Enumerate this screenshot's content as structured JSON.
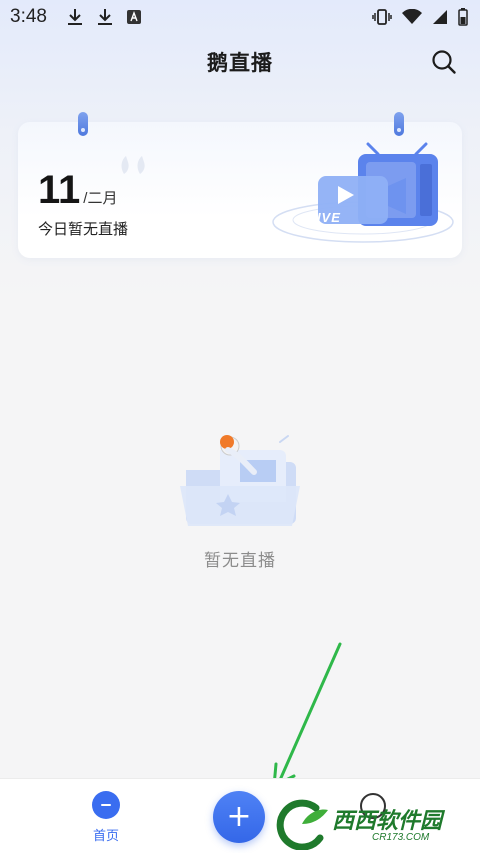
{
  "status_bar": {
    "time": "3:48",
    "left_icons": [
      "download-icon",
      "download-icon",
      "keyboard-a-icon"
    ],
    "right_icons": [
      "vibrate-icon",
      "wifi-icon",
      "signal-icon",
      "battery-icon"
    ]
  },
  "header": {
    "title": "鹅直播",
    "search_icon": "search-icon"
  },
  "calendar_card": {
    "day": "11",
    "slash": "/",
    "month": "二月",
    "subtitle": "今日暂无直播",
    "live_badge": "LIVE"
  },
  "empty_state": {
    "text": "暂无直播"
  },
  "bottom_nav": {
    "home_label": "首页",
    "add_symbol": "+"
  },
  "watermark": {
    "title": "西西软件园",
    "subtitle": "CR173.COM"
  },
  "colors": {
    "accent": "#3a6df0",
    "annotation_arrow": "#2fb84a",
    "watermark": "#1f7a2c"
  }
}
